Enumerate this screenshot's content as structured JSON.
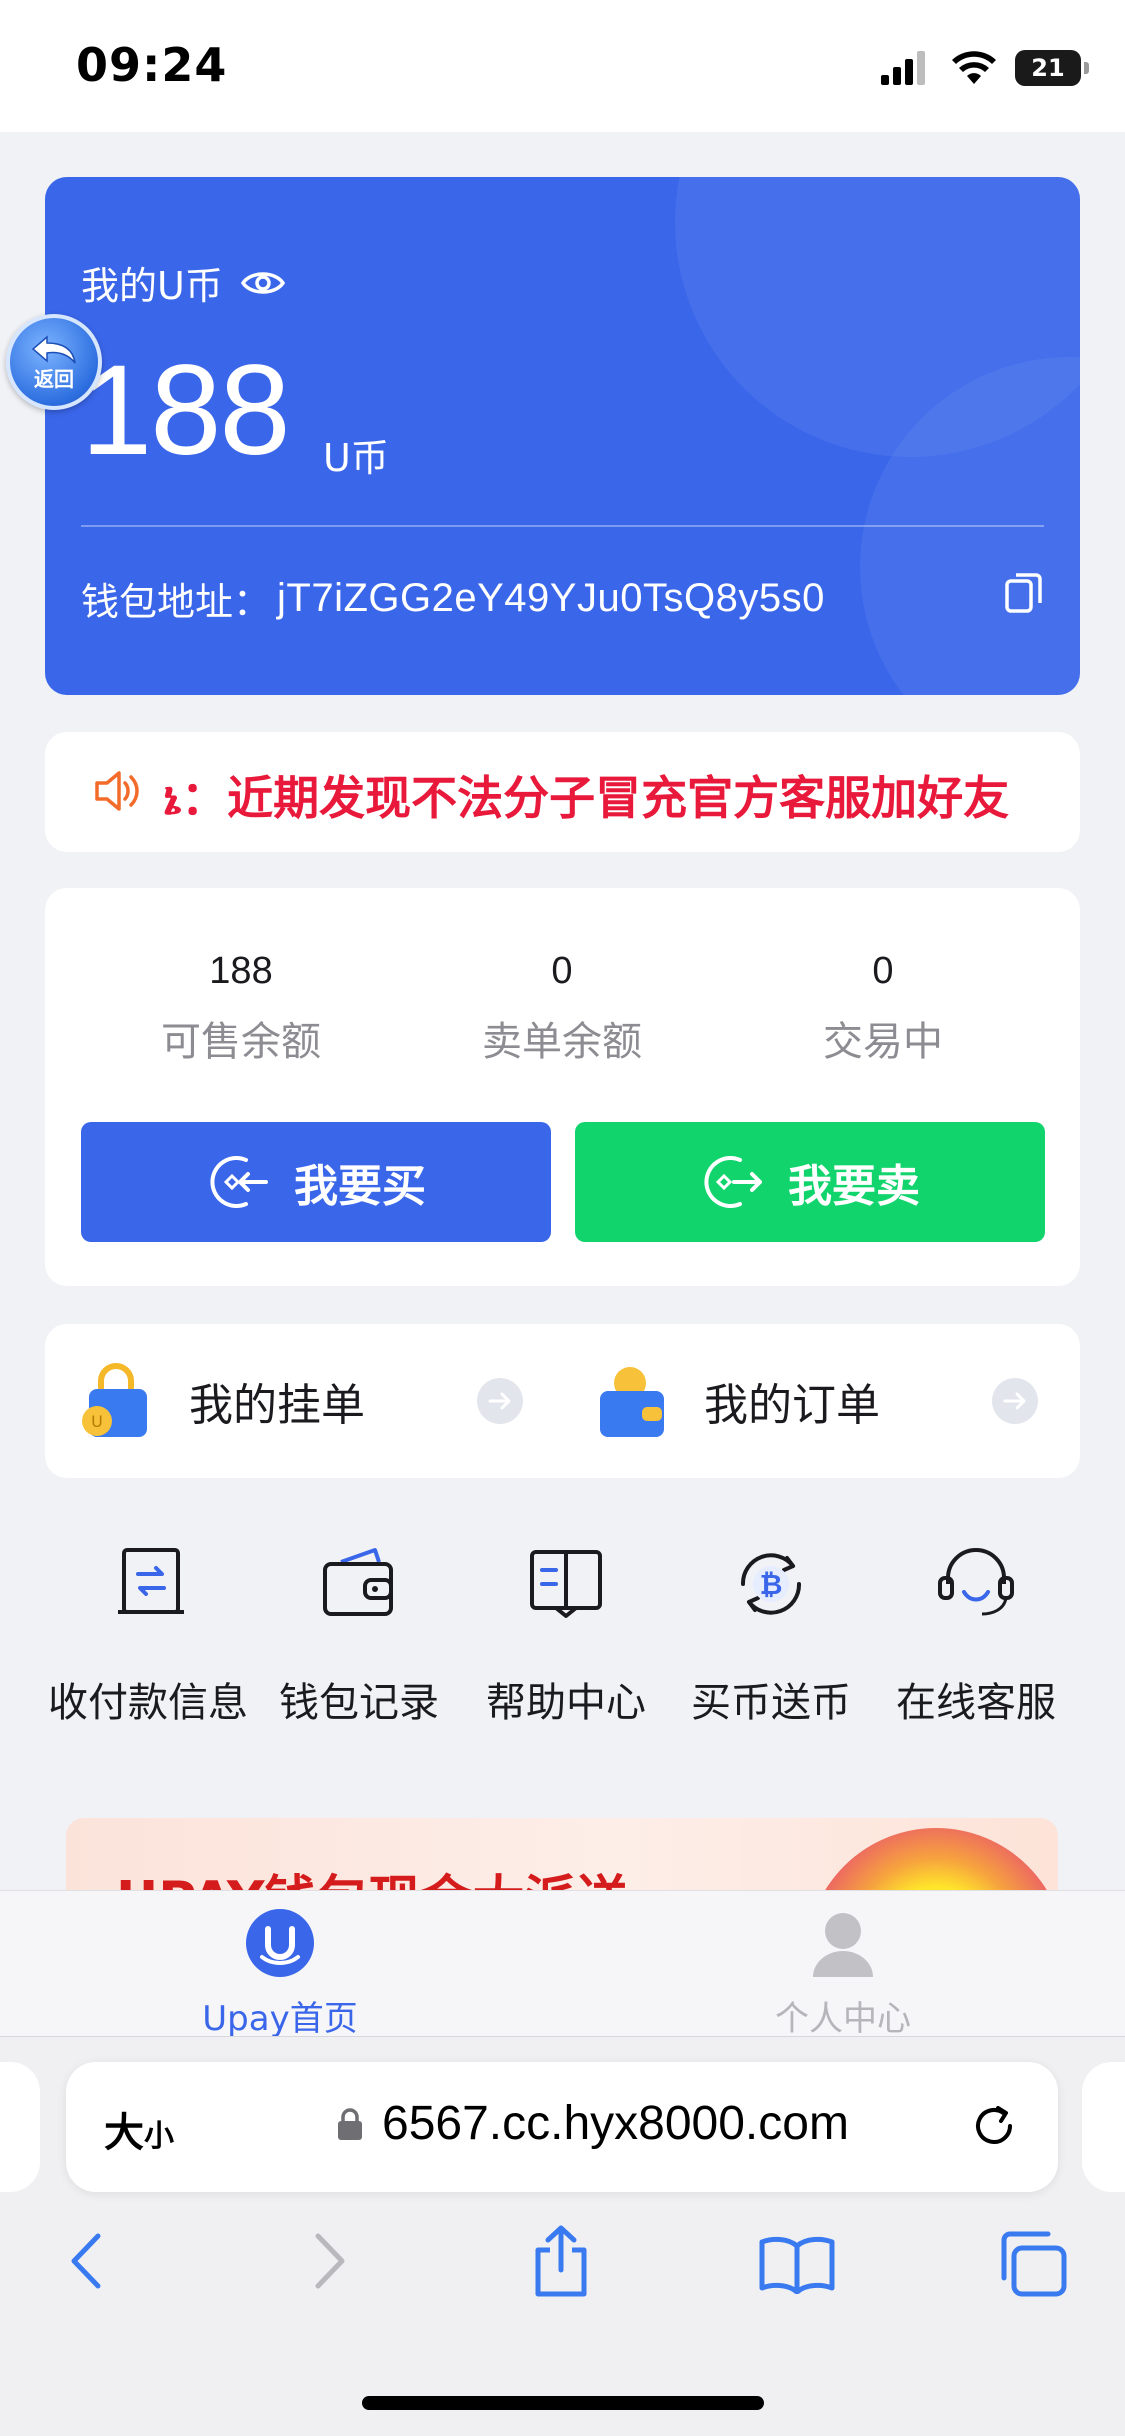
{
  "status": {
    "time": "09:24",
    "battery": "21"
  },
  "wallet": {
    "title": "我的U币",
    "balance": "188",
    "unit": "U币",
    "address_label": "钱包地址：",
    "address": "jT7iZGG2eY49YJu0TsQ8y5s0"
  },
  "back_button": {
    "label": "返回"
  },
  "notice": {
    "text": "ኔ：近期发现不法分子冒充官方客服加好友"
  },
  "stats": [
    {
      "value": "188",
      "label": "可售余额"
    },
    {
      "value": "0",
      "label": "卖单余额"
    },
    {
      "value": "0",
      "label": "交易中"
    }
  ],
  "actions": {
    "buy": "我要买",
    "sell": "我要卖"
  },
  "orders": {
    "my_listings": "我的挂单",
    "my_orders": "我的订单"
  },
  "grid": [
    {
      "label": "收付款信息",
      "icon": "payment-info-icon"
    },
    {
      "label": "钱包记录",
      "icon": "wallet-icon"
    },
    {
      "label": "帮助中心",
      "icon": "help-book-icon"
    },
    {
      "label": "买币送币",
      "icon": "bitcoin-icon"
    },
    {
      "label": "在线客服",
      "icon": "support-headset-icon"
    }
  ],
  "banner": {
    "text": "UPAY钱包现金大派送"
  },
  "tabbar": {
    "home": "Upay首页",
    "user": "个人中心"
  },
  "browser": {
    "text_size": "大",
    "text_size_small": "小",
    "url": "6567.cc.hyx8000.com"
  },
  "colors": {
    "primary": "#3a66ea",
    "sell": "#12d46d",
    "notice": "#e8193a"
  }
}
